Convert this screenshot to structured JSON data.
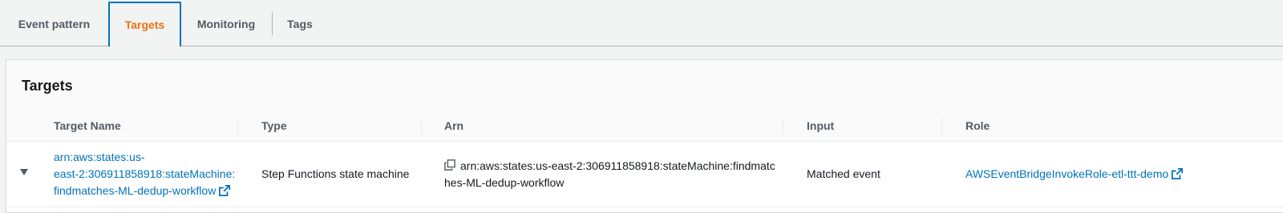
{
  "tabs": [
    {
      "label": "Event pattern",
      "active": false
    },
    {
      "label": "Targets",
      "active": true
    },
    {
      "label": "Monitoring",
      "active": false
    },
    {
      "label": "Tags",
      "active": false
    }
  ],
  "panel": {
    "title": "Targets",
    "columns": [
      "Target Name",
      "Type",
      "Arn",
      "Input",
      "Role"
    ],
    "rows": [
      {
        "target_name_lines": [
          "arn:aws:states:us-",
          "east-2:306911858918:stateMachine:",
          "findmatches-ML-dedup-workflow"
        ],
        "type": "Step Functions state machine",
        "arn_lines": [
          "arn:aws:states:us-east-2:306911858918:stateMachine:findmatc",
          "hes-ML-dedup-workflow"
        ],
        "input": "Matched event",
        "role": "AWSEventBridgeInvokeRole-etl-ttt-demo"
      }
    ]
  },
  "icons": {
    "external_link": "external-link-icon",
    "copy": "copy-icon",
    "expand": "caret-down-icon"
  },
  "colors": {
    "active_tab_text": "#ec7211",
    "active_tab_border": "#0073bb",
    "link": "#0073bb"
  }
}
